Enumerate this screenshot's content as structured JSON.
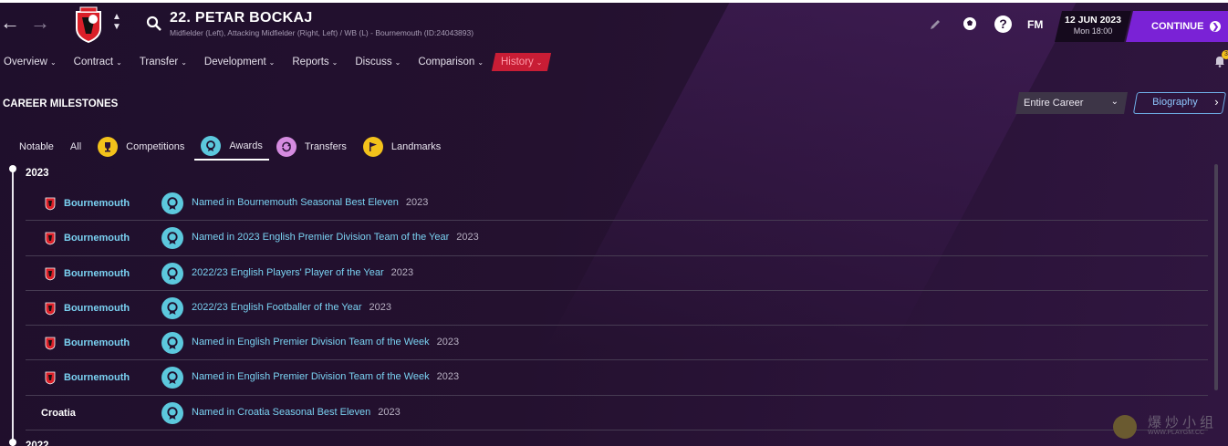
{
  "header": {
    "player_title": "22. PETAR BOCKAJ",
    "player_subtitle": "Midfielder (Left), Attacking Midfielder (Right, Left) / WB (L) - Bournemouth (ID:24043893)",
    "fm_label": "FM",
    "date": "12 JUN 2023",
    "time": "Mon 18:00",
    "continue_label": "CONTINUE",
    "icons": [
      "back-arrow-icon",
      "forward-arrow-icon",
      "club-crest-icon",
      "search-icon",
      "pencil-icon",
      "football-icon",
      "help-icon",
      "bell-icon"
    ],
    "notification_count": "3"
  },
  "menu": [
    {
      "label": "Overview"
    },
    {
      "label": "Contract"
    },
    {
      "label": "Transfer"
    },
    {
      "label": "Development"
    },
    {
      "label": "Reports"
    },
    {
      "label": "Discuss"
    },
    {
      "label": "Comparison"
    },
    {
      "label": "History",
      "active": true
    }
  ],
  "section": {
    "title": "CAREER MILESTONES",
    "period_select": "Entire Career",
    "biography_label": "Biography"
  },
  "filters": [
    {
      "label": "Notable"
    },
    {
      "label": "All"
    },
    {
      "label": "Competitions",
      "icon": "trophy-icon",
      "color": "#f3c21b"
    },
    {
      "label": "Awards",
      "icon": "medal-icon",
      "color": "#5cc8dd",
      "active": true
    },
    {
      "label": "Transfers",
      "icon": "transfer-icon",
      "color": "#d58be0"
    },
    {
      "label": "Landmarks",
      "icon": "flag-icon",
      "color": "#f3c21b"
    }
  ],
  "years": [
    "2023",
    "2022"
  ],
  "milestones": [
    {
      "club": "Bournemouth",
      "award": "Named in Bournemouth Seasonal Best Eleven",
      "year": "2023"
    },
    {
      "club": "Bournemouth",
      "award": "Named in 2023 English Premier Division Team of the Year",
      "year": "2023"
    },
    {
      "club": "Bournemouth",
      "award": "2022/23 English Players' Player of the Year",
      "year": "2023"
    },
    {
      "club": "Bournemouth",
      "award": "2022/23 English Footballer of the Year",
      "year": "2023"
    },
    {
      "club": "Bournemouth",
      "award": "Named in English Premier Division Team of the Week",
      "year": "2023"
    },
    {
      "club": "Bournemouth",
      "award": "Named in English Premier Division Team of the Week",
      "year": "2023"
    },
    {
      "club": "Croatia",
      "award": "Named in Croatia Seasonal Best Eleven",
      "year": "2023"
    }
  ],
  "watermark": {
    "text": "爆炒小组",
    "url": "WWW.PLAYGM.CC"
  },
  "colors": {
    "accent_purple": "#7a22d6",
    "active_tab": "#c81d35",
    "link_blue": "#7ad2f2",
    "award_teal": "#5cc8dd"
  }
}
